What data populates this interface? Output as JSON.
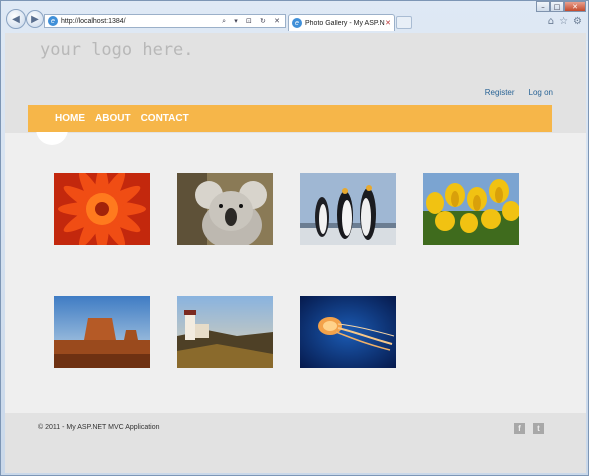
{
  "browser": {
    "url": "http://localhost:1384/",
    "tab_title": "Photo Gallery - My ASP.NE...",
    "address_tools": "⌕ ▾ ⊡ ↻ ✕",
    "tab_close": "✕",
    "window_buttons": [
      "–",
      "□",
      "✕"
    ],
    "right_icons": [
      "⌂",
      "☆",
      "⚙"
    ]
  },
  "header": {
    "logo_text": "your logo here.",
    "register_label": "Register",
    "login_label": "Log on"
  },
  "menu": {
    "items": [
      "HOME",
      "ABOUT",
      "CONTACT"
    ]
  },
  "gallery": {
    "photos": [
      {
        "name": "photo-red-flower"
      },
      {
        "name": "photo-koala"
      },
      {
        "name": "photo-penguins"
      },
      {
        "name": "photo-tulips"
      },
      {
        "name": "photo-desert"
      },
      {
        "name": "photo-lighthouse"
      },
      {
        "name": "photo-jellyfish"
      }
    ]
  },
  "footer": {
    "copyright": "© 2011 - My ASP.NET MVC Application",
    "social": [
      "f",
      "t"
    ]
  }
}
